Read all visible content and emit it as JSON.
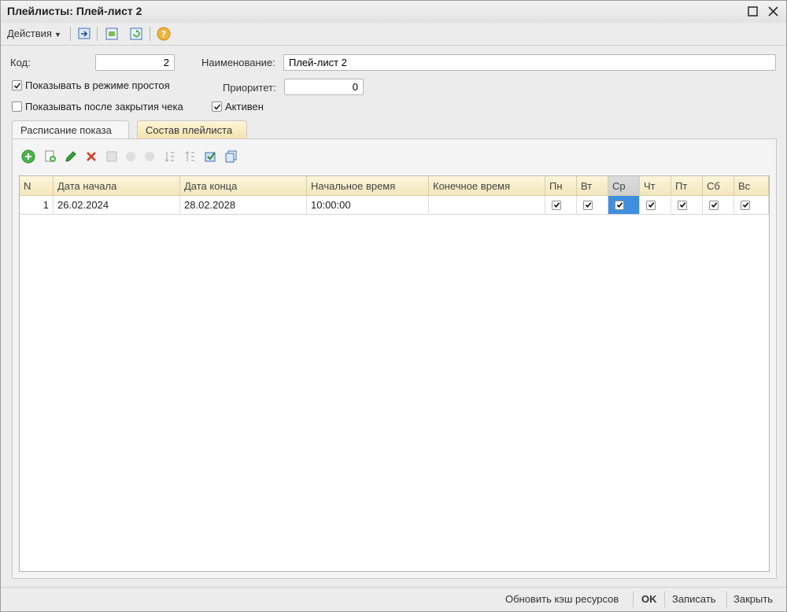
{
  "window": {
    "title": "Плейлисты: Плей-лист 2"
  },
  "toolbar": {
    "actions_label": "Действия"
  },
  "form": {
    "code_label": "Код:",
    "code_value": "2",
    "name_label": "Наименование:",
    "name_value": "Плей-лист 2",
    "priority_label": "Приоритет:",
    "priority_value": "0",
    "show_idle_label": "Показывать в режиме простоя",
    "show_idle_checked": true,
    "show_after_receipt_label": "Показывать после закрытия чека",
    "show_after_receipt_checked": false,
    "active_label": "Активен",
    "active_checked": true
  },
  "tabs": [
    {
      "label": "Расписание показа",
      "active": true
    },
    {
      "label": "Состав плейлиста",
      "active": false
    }
  ],
  "table": {
    "columns": [
      "N",
      "Дата начала",
      "Дата конца",
      "Начальное время",
      "Конечное время",
      "Пн",
      "Вт",
      "Ср",
      "Чт",
      "Пт",
      "Сб",
      "Вс"
    ],
    "rows": [
      {
        "n": "1",
        "start_date": "26.02.2024",
        "end_date": "28.02.2028",
        "start_time": "10:00:00",
        "end_time": "",
        "mon": true,
        "tue": true,
        "wed": true,
        "thu": true,
        "fri": true,
        "sat": true,
        "sun": true
      }
    ]
  },
  "footer": {
    "refresh_cache_label": "Обновить кэш ресурсов",
    "ok_label": "OK",
    "save_label": "Записать",
    "close_label": "Закрыть"
  },
  "colors": {
    "accent": "#3f8fe0",
    "header_bg": "#f3e6bd",
    "add_icon": "#3aa33a",
    "delete_icon": "#d23a2a",
    "help_icon": "#e8a020"
  }
}
